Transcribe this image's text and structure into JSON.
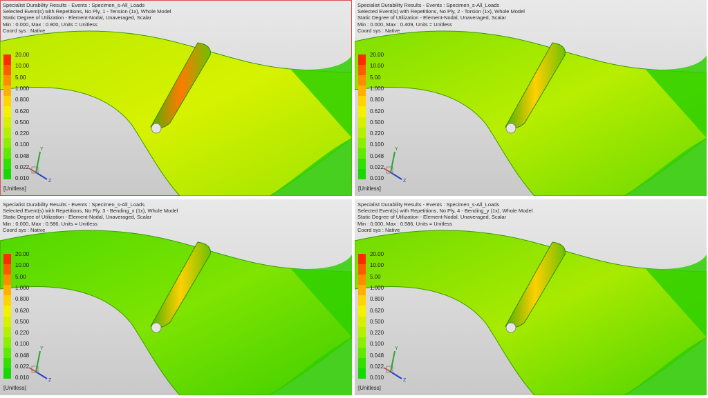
{
  "viewports": [
    {
      "lines": [
        "Specialist Durability Results - Events : Specimen_s-All_Loads",
        "Selected Event(s) with Repetitions, No Ply, 1 - Tension (1x), Whole Model",
        "Static Degree of Utilization - Element-Nodal, Unaveraged, Scalar",
        "Min : 0.000, Max : 0.900, Units = Unitless",
        "Coord sys : Native"
      ],
      "active": true
    },
    {
      "lines": [
        "Specialist Durability Results - Events : Specimen_s-All_Loads",
        "Selected Event(s) with Repetitions, No Ply, 2 - Torsion (1x), Whole Model",
        "Static Degree of Utilization - Element-Nodal, Unaveraged, Scalar",
        "Min : 0.000, Max : 0.409, Units = Unitless",
        "Coord sys : Native"
      ],
      "active": false
    },
    {
      "lines": [
        "Specialist Durability Results - Events : Specimen_s-All_Loads",
        "Selected Event(s) with Repetitions, No Ply, 3 - Bending_x (1x), Whole Model",
        "Static Degree of Utilization - Element-Nodal, Unaveraged, Scalar",
        "Min : 0.000, Max : 0.586, Units = Unitless",
        "Coord sys : Native"
      ],
      "active": false
    },
    {
      "lines": [
        "Specialist Durability Results - Events : Specimen_s-All_Loads",
        "Selected Event(s) with Repetitions, No Ply, 4 - Bending_y (1x), Whole Model",
        "Static Degree of Utilization - Element-Nodal, Unaveraged, Scalar",
        "Min : 0.000, Max : 0.586, Units = Unitless",
        "Coord sys : Native"
      ],
      "active": false
    }
  ],
  "legend": {
    "labels": [
      "20.00",
      "10.00",
      "5.00",
      "1.000",
      "0.800",
      "0.620",
      "0.500",
      "0.220",
      "0.100",
      "0.048",
      "0.022",
      "0.010"
    ],
    "colors": [
      "#ff2a00",
      "#ff5a00",
      "#ff8c00",
      "#ffb000",
      "#ffd400",
      "#f3f000",
      "#d6f000",
      "#b4f000",
      "#8cef00",
      "#5fea00",
      "#32e000",
      "#17d800"
    ],
    "unit": "[Unitless]"
  },
  "triad": {
    "y_label": "Y",
    "z_label": "Z"
  },
  "colors": {
    "band_tension": "#ff7a00",
    "band_other": "#ffd000",
    "model_green": "#3fd800",
    "model_yellow": "#c6ef00"
  }
}
